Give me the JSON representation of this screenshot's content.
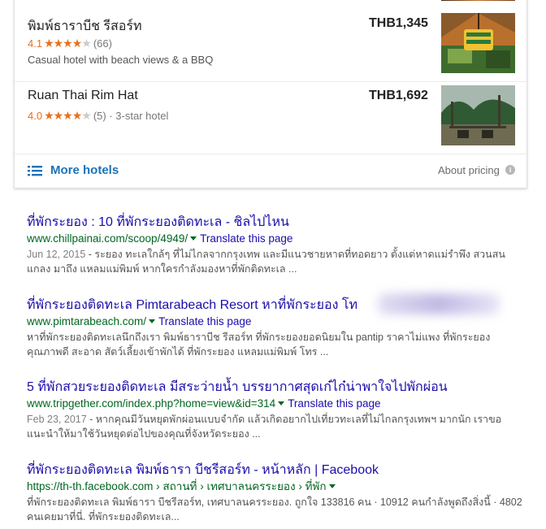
{
  "hotels": [
    {
      "name": "พิมพ์ธาราบีช รีสอร์ท",
      "rating": "4.1",
      "reviews": "(66)",
      "type": "",
      "desc": "Casual hotel with beach views & a BBQ",
      "price": "THB1,345"
    },
    {
      "name": "Ruan Thai Rim Hat",
      "rating": "4.0",
      "reviews": "(5)",
      "type": "· 3-star hotel",
      "desc": "",
      "price": "THB1,692"
    }
  ],
  "stars": {
    "full": "★★★★",
    "empty": "★"
  },
  "footer": {
    "more_hotels": "More hotels",
    "about_pricing": "About pricing",
    "info_icon": "i"
  },
  "results": [
    {
      "title": "ที่พักระยอง : 10 ที่พักระยองติดทะเล - ชิลไปไหน",
      "url": "www.chillpainai.com/scoop/4949/",
      "translate": "Translate this page",
      "date": "Jun 12, 2015",
      "snippet": " - ระยอง ทะเลใกล้ๆ ที่ไม่ไกลจากกรุงเทพ และมีแนวชายหาดที่ทอดยาว ตั้งแต่หาดแม่รำพึง สวนสน แกลง มาถึง แหลมแม่พิมพ์ หากใครกำลังมองหาที่พักติดทะเล ..."
    },
    {
      "title": "ที่พักระยองติดทะเล Pimtarabeach Resort หาที่พักระยอง โท",
      "url": "www.pimtarabeach.com/",
      "translate": "Translate this page",
      "date": "",
      "snippet": "หาที่พักระยองติดทะเลนึกถึงเรา พิมพ์ธาราบีช รีสอร์ท ที่พักระยองยอดนิยมใน pantip ราคาไม่แพง ที่พักระยองคุณภาพดี สะอาด สัตว์เลี้ยงเข้าพักได้ ที่พักระยอง แหลมแม่พิมพ์ โทร ..."
    },
    {
      "title": "5 ที่พักสวยระยองติดทะเล มีสระว่ายน้ำ บรรยากาศสุดเก๋ไก๋น่าพาใจไปพักผ่อน",
      "url": "www.tripgether.com/index.php?home=view&id=314",
      "translate": "Translate this page",
      "date": "Feb 23, 2017",
      "snippet": " - หากคุณมีวันหยุดพักผ่อนแบบจำกัด แล้วเกิดอยากไปเที่ยวทะเลที่ไม่ไกลกรุงเทพฯ มากนัก เราขอแนะนำให้มาใช้วันหยุดต่อไปของคุณที่จังหวัดระยอง ..."
    },
    {
      "title": "ที่พักระยองติดทะเล พิมพ์ธารา บีชรีสอร์ท - หน้าหลัก | Facebook",
      "url": "https://th-th.facebook.com › สถานที่ › เทศบาลนครระยอง › ที่พัก",
      "translate": "",
      "date": "",
      "snippet": "ที่พักระยองติดทะเล พิมพ์ธารา บีชรีสอร์ท, เทศบาลนครระยอง. ถูกใจ 133816 คน · 10912 คนกำลังพูดถึงสิ่งนี้ · 4802 คนเคยมาที่นี่. ที่พักระยองติดทะเล..."
    }
  ]
}
